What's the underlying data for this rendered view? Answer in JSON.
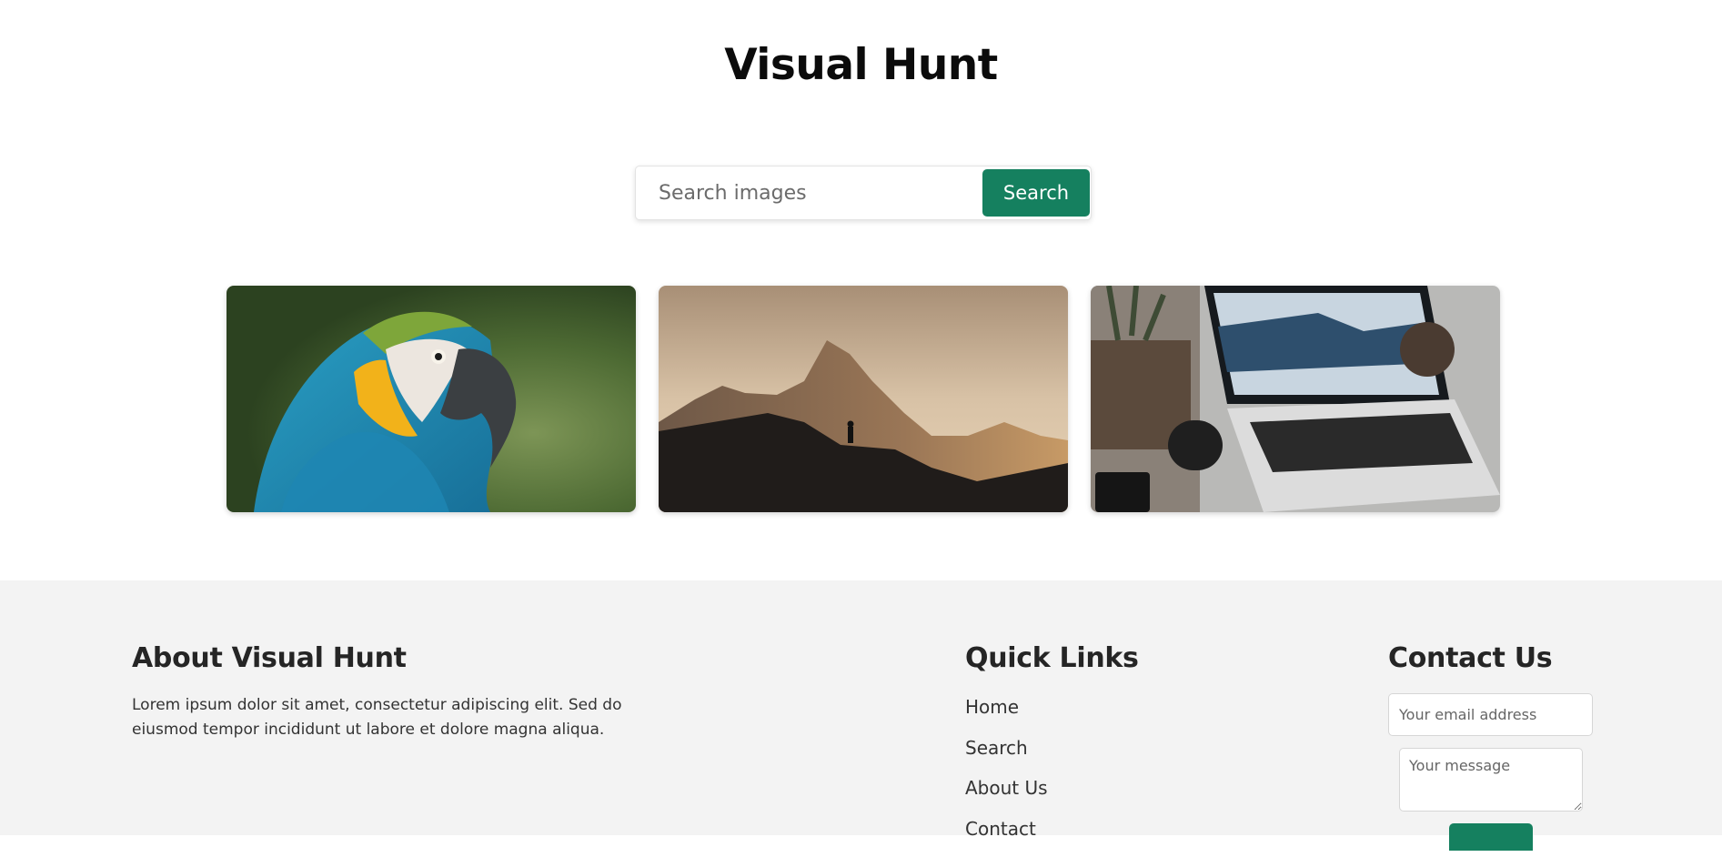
{
  "header": {
    "title": "Visual Hunt"
  },
  "search": {
    "placeholder": "Search images",
    "button_label": "Search"
  },
  "gallery": [
    {
      "subject": "macaw parrot"
    },
    {
      "subject": "mountain silhouette at sunset"
    },
    {
      "subject": "laptop on desk"
    }
  ],
  "footer": {
    "about": {
      "heading": "About Visual Hunt",
      "text": "Lorem ipsum dolor sit amet, consectetur adipiscing elit. Sed do eiusmod tempor incididunt ut labore et dolore magna aliqua."
    },
    "quick_links": {
      "heading": "Quick Links",
      "items": [
        "Home",
        "Search",
        "About Us",
        "Contact"
      ]
    },
    "contact": {
      "heading": "Contact Us",
      "email_placeholder": "Your email address",
      "message_placeholder": "Your message"
    }
  },
  "colors": {
    "accent": "#15805f",
    "footer_background": "#f3f3f3"
  }
}
